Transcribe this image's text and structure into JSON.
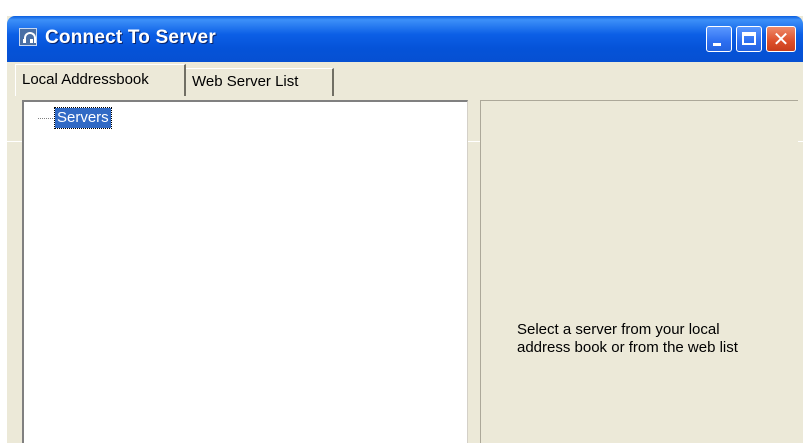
{
  "window": {
    "title": "Connect To Server",
    "icon": "headset-icon",
    "controls": {
      "minimize": "minimize-icon",
      "maximize": "maximize-icon",
      "close_glyph": "✕"
    }
  },
  "tabs": [
    {
      "label": "Local Addressbook",
      "selected": true
    },
    {
      "label": "Web Server List",
      "selected": false
    }
  ],
  "tree": {
    "nodes": [
      {
        "label": "Servers",
        "selected": true
      }
    ]
  },
  "info": {
    "message": "Select a server from your local\naddress book or from the web list"
  },
  "colors": {
    "titlebar": "#0553d8",
    "window_bg": "#ece9d8",
    "selection": "#316ac5",
    "close_button": "#dd4f2a"
  }
}
